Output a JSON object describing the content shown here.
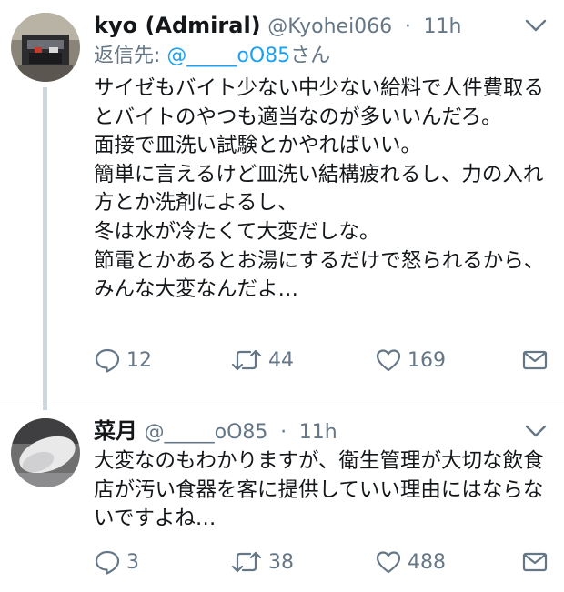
{
  "tweets": [
    {
      "display_name": "kyo (Admiral)",
      "handle": "@Kyohei066",
      "separator": "·",
      "time": "11h",
      "reply_prefix": "返信先: ",
      "reply_mention": "@_____oO85",
      "reply_suffix": "さん",
      "text": "サイゼもバイト少ない中少ない給料で人件費取るとバイトのやつも適当なのが多いいんだろ。\n面接で皿洗い試験とかやればいい。\n簡単に言えるけど皿洗い結構疲れるし、力の入れ方とか洗剤によるし、\n冬は水が冷たくて大変だしな。\n節電とかあるとお湯にするだけで怒られるから、みんな大変なんだよ…",
      "replies": "12",
      "retweets": "44",
      "likes": "169",
      "icons": {
        "reply": "reply-icon",
        "retweet": "retweet-icon",
        "like": "heart-icon",
        "dm": "envelope-icon",
        "caret": "chevron-down-icon"
      }
    },
    {
      "display_name": "菜月",
      "handle": "@_____oO85",
      "separator": "·",
      "time": "11h",
      "text": "大変なのもわかりますが、衛生管理が大切な飲食店が汚い食器を客に提供していい理由にはならないですよね…",
      "replies": "3",
      "retweets": "38",
      "likes": "488",
      "icons": {
        "reply": "reply-icon",
        "retweet": "retweet-icon",
        "like": "heart-icon",
        "dm": "envelope-icon",
        "caret": "chevron-down-icon"
      }
    }
  ],
  "colors": {
    "text": "#14171a",
    "secondary": "#657786",
    "link": "#1da1f2",
    "thread_line": "#ccd6dd",
    "divider": "#e6ecf0"
  }
}
